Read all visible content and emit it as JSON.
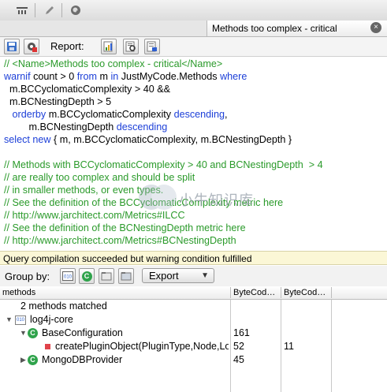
{
  "tab": {
    "title": "Methods too complex - critical",
    "close_label": "×"
  },
  "toolbar": {
    "report_label": "Report:"
  },
  "code_lines": [
    [
      {
        "t": "// <Name>Methods too complex - critical</Name>",
        "s": "c"
      }
    ],
    [
      {
        "t": "warnif",
        "s": "k"
      },
      {
        "t": " count > 0 ",
        "s": ""
      },
      {
        "t": "from",
        "s": "k"
      },
      {
        "t": " m ",
        "s": ""
      },
      {
        "t": "in",
        "s": "k"
      },
      {
        "t": " JustMyCode.Methods ",
        "s": ""
      },
      {
        "t": "where",
        "s": "k"
      }
    ],
    [
      {
        "t": "  m.BCCyclomaticComplexity > 40 &&",
        "s": ""
      }
    ],
    [
      {
        "t": "  m.BCNestingDepth > 5",
        "s": ""
      }
    ],
    [
      {
        "t": "   ",
        "s": ""
      },
      {
        "t": "orderby",
        "s": "k"
      },
      {
        "t": " m.BCCyclomaticComplexity ",
        "s": ""
      },
      {
        "t": "descending",
        "s": "k"
      },
      {
        "t": ",",
        "s": ""
      }
    ],
    [
      {
        "t": "         m.BCNestingDepth ",
        "s": ""
      },
      {
        "t": "descending",
        "s": "k"
      }
    ],
    [
      {
        "t": "select",
        "s": "k"
      },
      {
        "t": " ",
        "s": ""
      },
      {
        "t": "new",
        "s": "k"
      },
      {
        "t": " { m, m.BCCyclomaticComplexity, m.BCNestingDepth }",
        "s": ""
      }
    ],
    [
      {
        "t": "",
        "s": ""
      }
    ],
    [
      {
        "t": "// Methods with BCCyclomaticComplexity > 40 and BCNestingDepth  > 4",
        "s": "c"
      }
    ],
    [
      {
        "t": "// are really too complex and should be split",
        "s": "c"
      }
    ],
    [
      {
        "t": "// in smaller methods, or even types.",
        "s": "c"
      }
    ],
    [
      {
        "t": "// See the definition of the BCCyclomaticComplexity metric here",
        "s": "c"
      }
    ],
    [
      {
        "t": "// http://www.jarchitect.com/Metrics#ILCC",
        "s": "c"
      }
    ],
    [
      {
        "t": "// See the definition of the BCNestingDepth metric here",
        "s": "c"
      }
    ],
    [
      {
        "t": "// http://www.jarchitect.com/Metrics#BCNestingDepth",
        "s": "c"
      }
    ]
  ],
  "status": {
    "message": "Query compilation succeeded but warning condition fulfilled"
  },
  "groupbar": {
    "label": "Group by:",
    "export_label": "Export"
  },
  "table": {
    "columns": [
      "methods",
      "ByteCod…",
      "ByteCod…"
    ],
    "summary": "2 methods matched",
    "rows": [
      {
        "name": "log4j-core",
        "c1": "",
        "c2": ""
      },
      {
        "name": "BaseConfiguration",
        "c1": "161",
        "c2": ""
      },
      {
        "name": "createPluginObject(PluginType,Node,Lo",
        "c1": "52",
        "c2": "11"
      },
      {
        "name": "MongoDBProvider",
        "c1": "45",
        "c2": ""
      }
    ]
  },
  "watermark": {
    "text": "小牛知识库"
  },
  "colors": {
    "comment": "#2a9a2a",
    "keyword": "#1c3fd8",
    "status_bg": "#fbf7d6"
  }
}
